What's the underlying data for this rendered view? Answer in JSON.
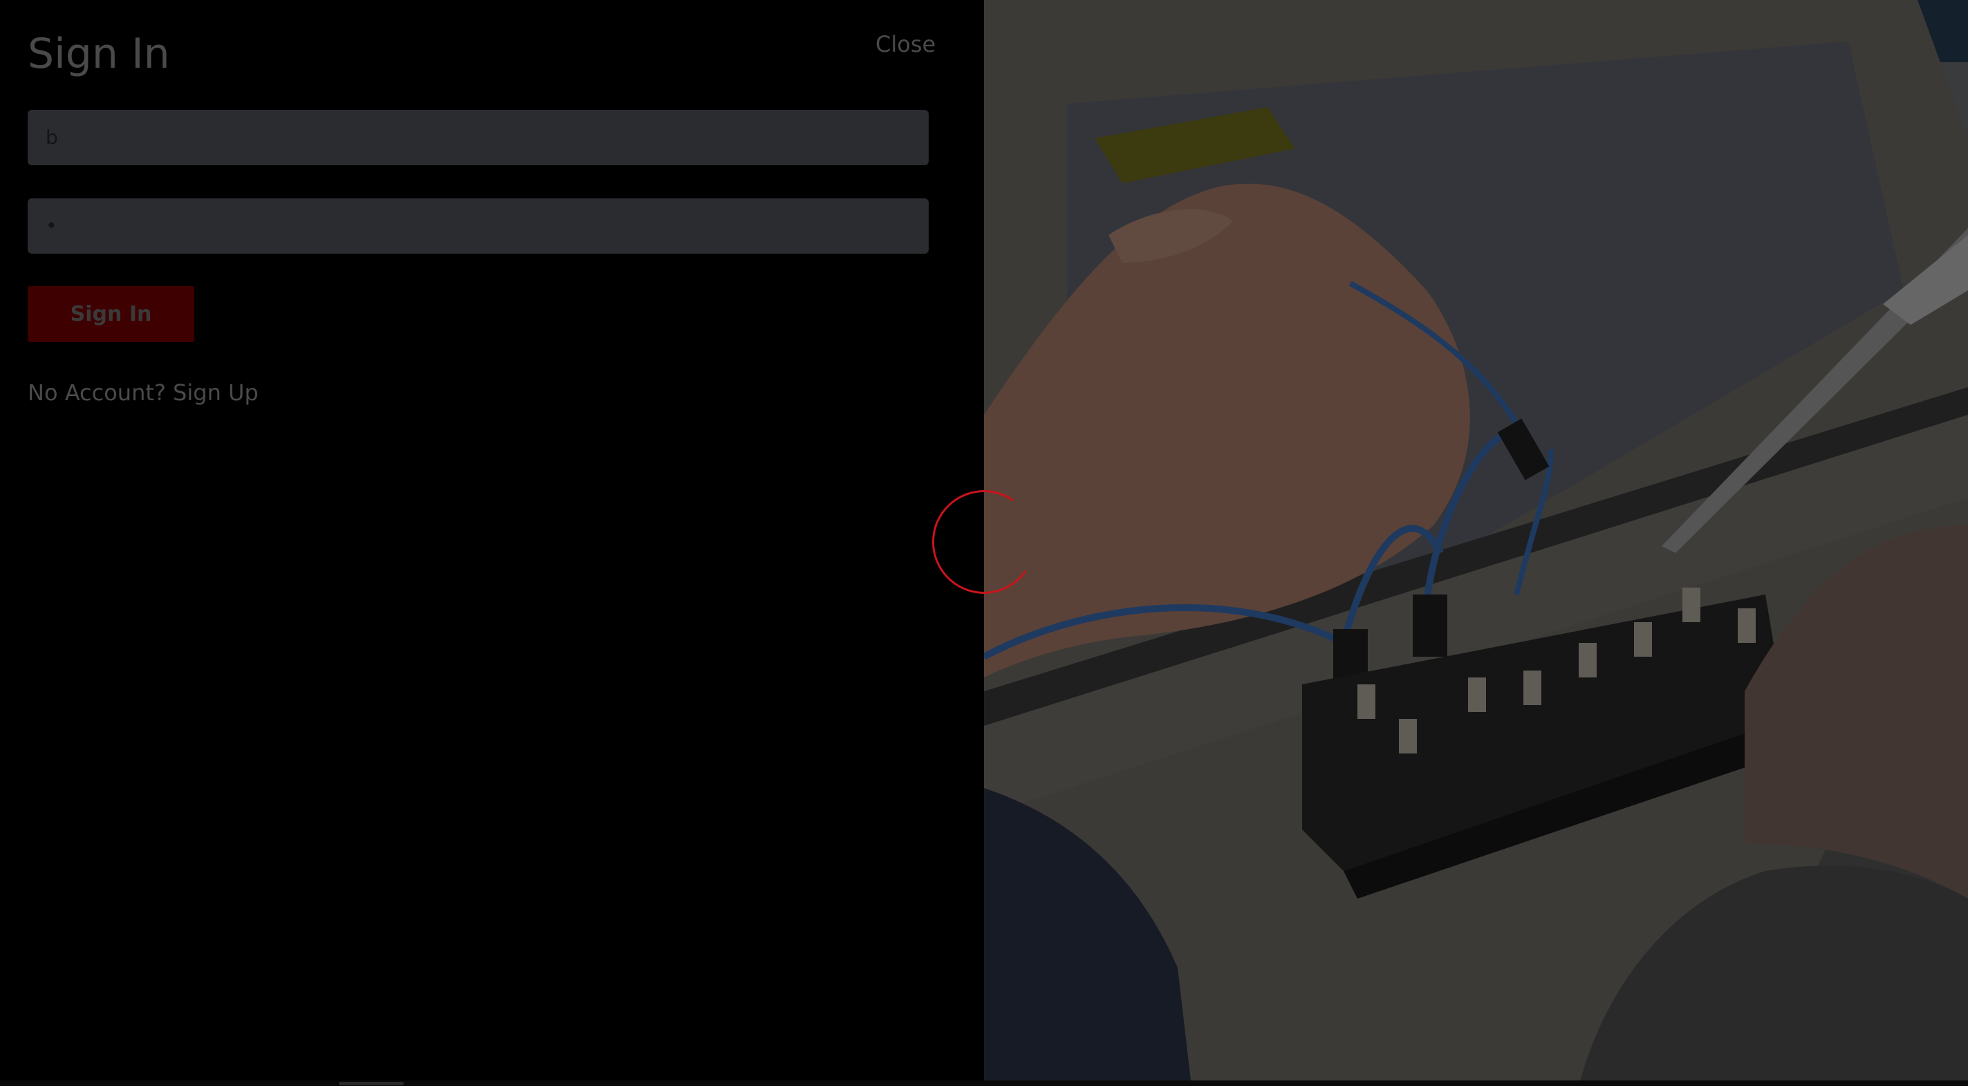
{
  "signin": {
    "title": "Sign In",
    "close_label": "Close",
    "username_value": "b",
    "password_value": "•",
    "submit_label": "Sign In",
    "signup_prompt": "No Account?",
    "signup_link": "Sign Up"
  },
  "loading": {
    "spinner_color": "#c9141b"
  },
  "colors": {
    "panel_background": "#000000",
    "field_background": "#2b2c30",
    "button_background": "#3e0000",
    "muted_text": "#4a4a4a"
  }
}
